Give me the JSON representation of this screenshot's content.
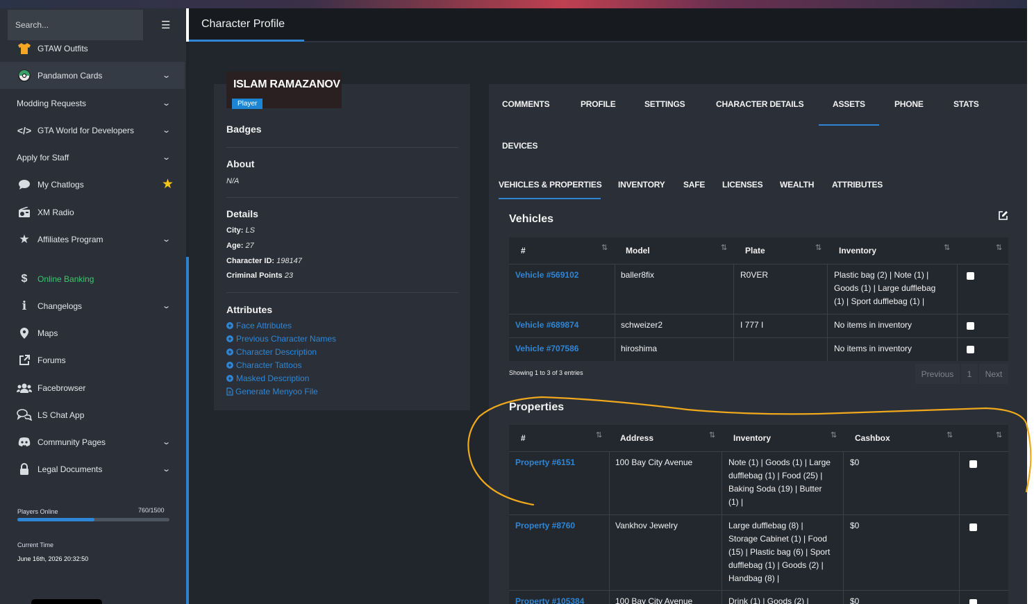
{
  "sidebar": {
    "search_placeholder": "Search...",
    "items": [
      {
        "label": "GTAW Outfits",
        "icon": "shirt-icon"
      },
      {
        "label": "Pandamon Cards",
        "icon": "pokeball-icon"
      },
      {
        "label": "Modding Requests"
      },
      {
        "label": "GTA World for Developers",
        "icon": "code-icon"
      },
      {
        "label": "Apply for Staff"
      },
      {
        "label": "My Chatlogs",
        "icon": "chat-bubble-icon"
      },
      {
        "label": "XM Radio",
        "icon": "radio-icon"
      },
      {
        "label": "Affiliates Program",
        "icon": "star-icon"
      },
      {
        "label": "Online Banking",
        "icon": "dollar-icon"
      },
      {
        "label": "Changelogs",
        "icon": "info-icon"
      },
      {
        "label": "Maps",
        "icon": "map-pin-icon"
      },
      {
        "label": "Forums",
        "icon": "external-link-icon"
      },
      {
        "label": "Facebrowser",
        "icon": "users-icon"
      },
      {
        "label": "LS Chat App",
        "icon": "chat-icon"
      },
      {
        "label": "Community Pages",
        "icon": "discord-icon"
      },
      {
        "label": "Legal Documents",
        "icon": "lock-icon"
      }
    ],
    "players_online_label": "Players Online",
    "players_online_count": "760/1500",
    "players_online_fraction": 0.507,
    "current_time_label": "Current Time",
    "current_time_value": "June 16th, 2026 20:32:50"
  },
  "header": {
    "title": "Character Profile"
  },
  "profile": {
    "name": "ISLAM RAMAZANOV",
    "role_badge": "Player",
    "badges_heading": "Badges",
    "about_heading": "About",
    "about_value": "N/A",
    "details_heading": "Details",
    "city_label": "City:",
    "city_value": "LS",
    "age_label": "Age:",
    "age_value": "27",
    "charid_label": "Character ID:",
    "charid_value": "198147",
    "criminal_label": "Criminal Points",
    "criminal_value": "23",
    "attributes_heading": "Attributes",
    "attribute_links": [
      "Face Attributes",
      "Previous Character Names",
      "Character Description",
      "Character Tattoos",
      "Masked Description",
      "Generate Menyoo File"
    ]
  },
  "tabs": {
    "primary": [
      "COMMENTS",
      "PROFILE",
      "SETTINGS",
      "CHARACTER DETAILS",
      "ASSETS",
      "PHONE",
      "STATS",
      "DEVICES"
    ],
    "active_primary": "ASSETS",
    "secondary": [
      "VEHICLES & PROPERTIES",
      "INVENTORY",
      "SAFE",
      "LICENSES",
      "WEALTH",
      "ATTRIBUTES"
    ],
    "active_secondary": "VEHICLES & PROPERTIES"
  },
  "vehicles": {
    "title": "Vehicles",
    "columns": [
      "#",
      "Model",
      "Plate",
      "Inventory"
    ],
    "rows": [
      {
        "id": "Vehicle #569102",
        "model": "baller8fix",
        "plate": "R0VER",
        "inventory": [
          "Plastic bag (2) | Note (1) |",
          "Goods (1) | Large dufflebag",
          "(1) | Sport dufflebag (1) |"
        ]
      },
      {
        "id": "Vehicle #689874",
        "model": "schweizer2",
        "plate": "I 777 I",
        "inventory": [
          "No items in inventory"
        ]
      },
      {
        "id": "Vehicle #707586",
        "model": "hiroshima",
        "plate": "",
        "inventory": [
          "No items in inventory"
        ]
      }
    ],
    "showing": "Showing 1 to 3 of 3 entries",
    "pager": {
      "previous": "Previous",
      "page": "1",
      "next": "Next"
    }
  },
  "properties": {
    "title": "Properties",
    "columns": [
      "#",
      "Address",
      "Inventory",
      "Cashbox"
    ],
    "rows": [
      {
        "id": "Property #6151",
        "address": "100 Bay City Avenue",
        "inventory": [
          "Note (1) | Goods (1) | Large",
          "dufflebag (1) | Food (25) |",
          "Baking Soda (19) | Butter",
          "(1) |"
        ],
        "cashbox": "$0"
      },
      {
        "id": "Property #8760",
        "address": "Vankhov Jewelry",
        "inventory": [
          "Large dufflebag (8) |",
          "Storage Cabinet (1) | Food",
          "(15) | Plastic bag (6) | Sport",
          "dufflebag (1) | Goods (2) |",
          "Handbag (8) |"
        ],
        "cashbox": "$0"
      },
      {
        "id": "Property #105384",
        "address": "100 Bay City Avenue",
        "inventory": [
          "Drink (1) | Goods (2) |"
        ],
        "cashbox": "$0"
      }
    ]
  },
  "colors": {
    "accent": "#2f86d6",
    "banking": "#3ac76b",
    "star": "#f5c518",
    "annotation": "#f0a81c"
  }
}
